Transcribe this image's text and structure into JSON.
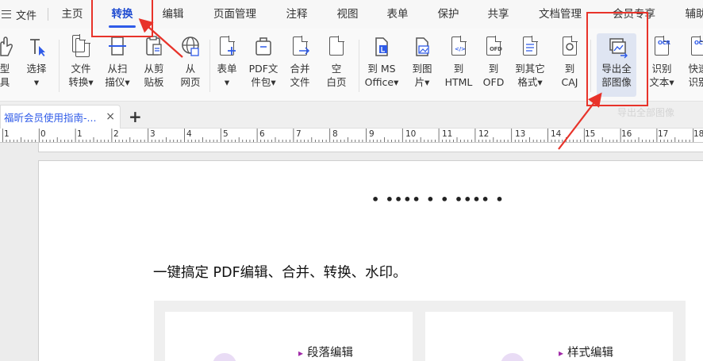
{
  "menubar": {
    "file_label": "文件",
    "tabs": [
      {
        "label": "主页"
      },
      {
        "label": "转换"
      },
      {
        "label": "编辑"
      },
      {
        "label": "页面管理"
      },
      {
        "label": "注释"
      },
      {
        "label": "视图"
      },
      {
        "label": "表单"
      },
      {
        "label": "保护"
      },
      {
        "label": "共享"
      },
      {
        "label": "文档管理"
      },
      {
        "label": "会员专享"
      },
      {
        "label": "辅助"
      }
    ],
    "active_tab": "转换"
  },
  "ribbon": {
    "buttons": [
      {
        "line1": "型",
        "line2": "具"
      },
      {
        "line1": "选择",
        "line2": "▾"
      },
      {
        "line1": "文件",
        "line2": "转换▾"
      },
      {
        "line1": "从扫",
        "line2": "描仪▾"
      },
      {
        "line1": "从剪",
        "line2": "贴板"
      },
      {
        "line1": "从",
        "line2": "网页"
      },
      {
        "line1": "表单",
        "line2": "▾"
      },
      {
        "line1": "PDF文",
        "line2": "件包▾"
      },
      {
        "line1": "合并",
        "line2": "文件"
      },
      {
        "line1": "空",
        "line2": "白页"
      },
      {
        "line1": "到 MS",
        "line2": "Office▾"
      },
      {
        "line1": "到图",
        "line2": "片▾"
      },
      {
        "line1": "到",
        "line2": "HTML"
      },
      {
        "line1": "到",
        "line2": "OFD"
      },
      {
        "line1": "到其它",
        "line2": "格式▾"
      },
      {
        "line1": "到",
        "line2": "CAJ"
      },
      {
        "line1": "导出全",
        "line2": "部图像"
      },
      {
        "line1": "识别",
        "line2": "文本▾"
      },
      {
        "line1": "快速",
        "line2": "识别"
      }
    ],
    "icon_tags": {
      "html": "</>",
      "ofd": "OFD",
      "ocr": "OCR"
    }
  },
  "tabstrip": {
    "doc_tab_title": "福昕会员使用指南-...",
    "close_glyph": "×",
    "add_glyph": "+",
    "ghost_tooltip": "导出全部图像"
  },
  "ruler": {
    "numbers": [
      "1",
      "0",
      "1",
      "2",
      "3",
      "4",
      "5",
      "6",
      "7",
      "8",
      "9",
      "10",
      "11",
      "12",
      "13",
      "14",
      "15",
      "16",
      "17",
      "18"
    ]
  },
  "document": {
    "dots": "• •••• • • •••• •",
    "heading": "一键搞定 PDF编辑、合并、转换、水印。",
    "cards": [
      {
        "title": "段落编辑"
      },
      {
        "title": "样式编辑"
      }
    ]
  },
  "colors": {
    "accent": "#2f5be8",
    "annotation_red": "#e8332a",
    "active_tab_text": "#1f4bd1",
    "bullet_purple": "#a02aa8"
  }
}
